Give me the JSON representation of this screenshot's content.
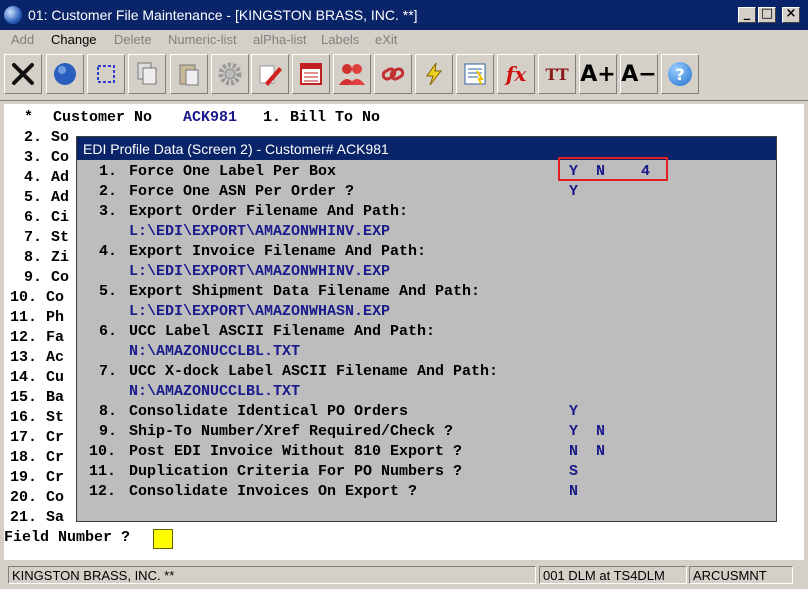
{
  "window": {
    "title": "01: Customer File Maintenance - [KINGSTON BRASS, INC. **]"
  },
  "menu": {
    "items": [
      {
        "label": "Add",
        "enabled": false
      },
      {
        "label": "Change",
        "enabled": true
      },
      {
        "label": "Delete",
        "enabled": false
      },
      {
        "label": "Numeric-list",
        "enabled": false
      },
      {
        "label": "alPha-list",
        "enabled": false
      },
      {
        "label": "Labels",
        "enabled": false
      },
      {
        "label": "eXit",
        "enabled": false
      }
    ]
  },
  "toolbar": {
    "icons": [
      "close-icon",
      "globe-icon",
      "select-icon",
      "copy-icon",
      "paste-icon",
      "settings-gear-icon",
      "edit-pencil-icon",
      "calendar-icon",
      "users-icon",
      "link-icon",
      "lightning-icon",
      "notes-icon",
      "function-fx-icon",
      "text-size-icon",
      "font-increase-icon",
      "font-decrease-icon",
      "help-icon"
    ],
    "fx_label": "fx",
    "tt_label": "TT",
    "font_up_label": "A+",
    "font_down_label": "A−",
    "help_label": "?"
  },
  "screen": {
    "header": {
      "star": "*",
      "label": "Customer No",
      "value": "ACK981",
      "bill_to": "1. Bill To No"
    },
    "left_fields": [
      "2. So",
      "3. Co",
      "4. Ad",
      "5. Ad",
      "6. Ci",
      "7. St",
      "8. Zi",
      "9. Co",
      "10. Co",
      "11. Ph",
      "12. Fa",
      "13. Ac",
      "14. Cu",
      "15. Ba",
      "16. St",
      "17. Cr",
      "18. Cr",
      "19. Cr",
      "20. Co",
      "21. Sa"
    ],
    "field_number_label": "Field Number ?"
  },
  "dialog": {
    "title": "EDI Profile Data (Screen 2) - Customer# ACK981",
    "items": [
      {
        "num": "1.",
        "label": "Force One Label Per Box",
        "value": "Y  N    4"
      },
      {
        "num": "2.",
        "label": "Force One ASN Per Order ?",
        "value": "Y"
      },
      {
        "num": "3.",
        "label": "Export Order Filename And Path:",
        "path": "L:\\EDI\\EXPORT\\AMAZONWHINV.EXP"
      },
      {
        "num": "4.",
        "label": "Export Invoice Filename And Path:",
        "path": "L:\\EDI\\EXPORT\\AMAZONWHINV.EXP"
      },
      {
        "num": "5.",
        "label": "Export Shipment Data Filename And Path:",
        "path": "L:\\EDI\\EXPORT\\AMAZONWHASN.EXP"
      },
      {
        "num": "6.",
        "label": "UCC Label ASCII Filename And Path:",
        "path": "N:\\AMAZONUCCLBL.TXT"
      },
      {
        "num": "7.",
        "label": "UCC X-dock Label ASCII Filename And Path:",
        "path": "N:\\AMAZONUCCLBL.TXT"
      },
      {
        "num": "8.",
        "label": "Consolidate Identical PO Orders",
        "value": "Y"
      },
      {
        "num": "9.",
        "label": "Ship-To Number/Xref Required/Check ?",
        "value": "Y  N"
      },
      {
        "num": "10.",
        "label": "Post EDI Invoice Without 810 Export ?",
        "value": "N  N"
      },
      {
        "num": "11.",
        "label": "Duplication Criteria For PO Numbers ?",
        "value": "S"
      },
      {
        "num": "12.",
        "label": "Consolidate Invoices On Export ?",
        "value": "N"
      }
    ]
  },
  "statusbar": {
    "company": "KINGSTON BRASS, INC. **",
    "session": "001 DLM at TS4DLM",
    "program": "ARCUSMNT"
  },
  "colors": {
    "title_bar": "#0a246a",
    "field_value": "#1a1a8c",
    "highlight_box": "#e02020",
    "input_cursor": "#ffff00"
  }
}
